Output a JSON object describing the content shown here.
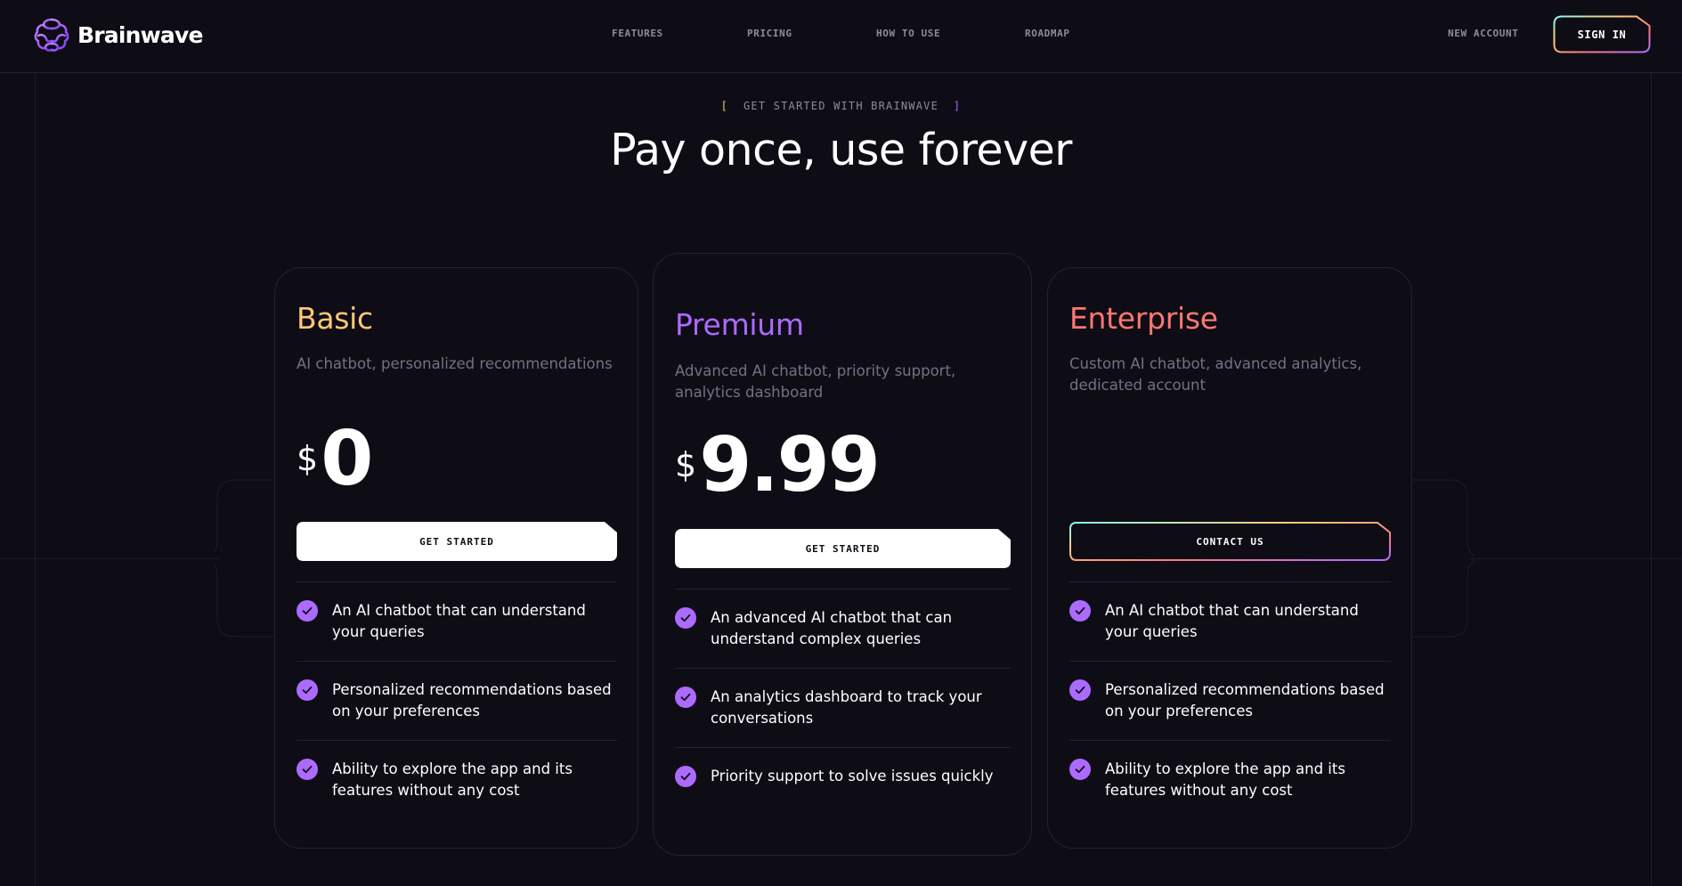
{
  "header": {
    "brand": {
      "name": "Brainwave",
      "logo_icon": "brain-logo-icon"
    },
    "nav": [
      {
        "label": "FEATURES"
      },
      {
        "label": "PRICING"
      },
      {
        "label": "HOW TO USE"
      },
      {
        "label": "ROADMAP"
      }
    ],
    "new_account_label": "NEW ACCOUNT",
    "sign_in_label": "SIGN IN"
  },
  "section": {
    "eyebrow": "GET STARTED WITH BRAINWAVE",
    "eyebrow_open": "[",
    "eyebrow_close": "]",
    "headline": "Pay once, use forever"
  },
  "plans": [
    {
      "title": "Basic",
      "description": "AI chatbot, personalized recommendations",
      "currency": "$",
      "price": "0",
      "cta": "GET STARTED",
      "features": [
        "An AI chatbot that can understand your queries",
        "Personalized recommendations based on your preferences",
        "Ability to explore the app and its features without any cost"
      ]
    },
    {
      "title": "Premium",
      "description": "Advanced AI chatbot, priority support, analytics dashboard",
      "currency": "$",
      "price": "9.99",
      "cta": "GET STARTED",
      "features": [
        "An advanced AI chatbot that can understand complex queries",
        "An analytics dashboard to track your conversations",
        "Priority support to solve issues quickly"
      ]
    },
    {
      "title": "Enterprise",
      "description": "Custom AI chatbot, advanced analytics, dedicated account",
      "cta": "CONTACT US",
      "features": [
        "An AI chatbot that can understand your queries",
        "Personalized recommendations based on your preferences",
        "Ability to explore the app and its features without any cost"
      ]
    }
  ],
  "colors": {
    "background": "#0e0c15",
    "basic": "#ffc876",
    "premium": "#ac6aff",
    "enterprise": "#ff776f",
    "check": "#ac6aff",
    "muted_text": "#757185"
  },
  "icons": {
    "feature_check": "check-circle-icon"
  }
}
